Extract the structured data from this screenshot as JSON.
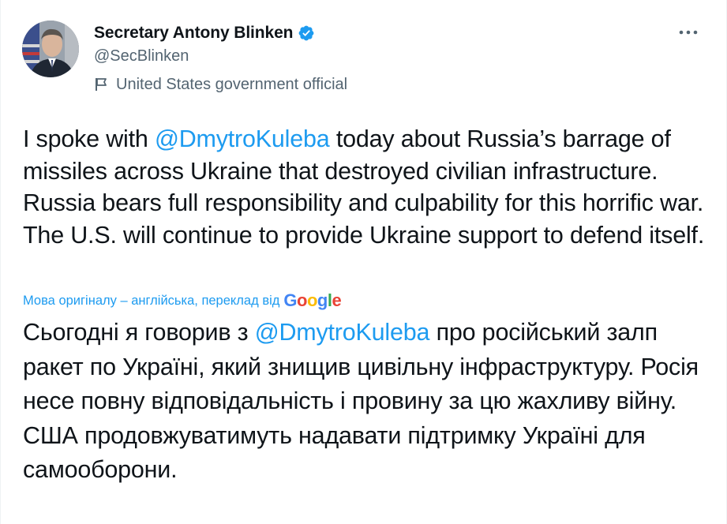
{
  "author": {
    "display_name": "Secretary Antony Blinken",
    "handle": "@SecBlinken",
    "account_label": "United States government official",
    "verified": true
  },
  "icons": {
    "verified": "verified-badge-icon",
    "label": "government-flag-icon",
    "more": "more-options-icon"
  },
  "colors": {
    "link": "#1d9bf0",
    "secondary_text": "#536471",
    "primary_text": "#0f1419",
    "verified": "#1d9bf0"
  },
  "tweet": {
    "text_before_mention": "I spoke with ",
    "mention": "@DmytroKuleba",
    "text_after_mention": " today about Russia’s barrage of missiles across Ukraine that destroyed civilian infrastructure. Russia bears full responsibility and culpability for this horrific war. The U.S. will continue to provide Ukraine support to defend itself."
  },
  "translation": {
    "label": "Мова оригіналу – англійська, переклад від",
    "provider": "Google",
    "text_before_mention": "Сьогодні я говорив з ",
    "mention": "@DmytroKuleba",
    "text_after_mention": " про російський залп ракет по Україні, який знищив цивільну інфраструктуру. Росія несе повну відповідальність і провину за цю жахливу війну. США продовжуватимуть надавати підтримку Україні для самооборони."
  }
}
